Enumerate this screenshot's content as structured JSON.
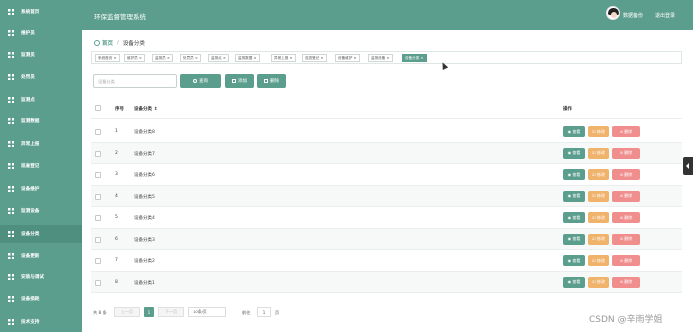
{
  "app_title": "环保监督管理系统",
  "header": {
    "user_name": "数据备份",
    "logout_label": "退出登录"
  },
  "sidebar": {
    "items": [
      {
        "label": "系统首页",
        "icon": "home-icon"
      },
      {
        "label": "维护员",
        "icon": "grid-icon"
      },
      {
        "label": "监测员",
        "icon": "grid-icon"
      },
      {
        "label": "处罚员",
        "icon": "grid-icon"
      },
      {
        "label": "监测点",
        "icon": "grid-icon"
      },
      {
        "label": "监测数据",
        "icon": "grid-icon"
      },
      {
        "label": "异常上报",
        "icon": "grid-icon"
      },
      {
        "label": "巡查登记",
        "icon": "grid-icon"
      },
      {
        "label": "设备维护",
        "icon": "grid-icon"
      },
      {
        "label": "监测设备",
        "icon": "briefcase-icon"
      },
      {
        "label": "设备分类",
        "icon": "grid-icon"
      },
      {
        "label": "设备更新",
        "icon": "grid-icon"
      },
      {
        "label": "安装与调试",
        "icon": "grid-icon"
      },
      {
        "label": "设备损耗",
        "icon": "pin-icon"
      },
      {
        "label": "技术支持",
        "icon": "grid-icon"
      }
    ],
    "active_index": 10
  },
  "breadcrumb": {
    "home": "首页",
    "separator": "/",
    "current": "设备分类"
  },
  "tabs": [
    "系统首页 ×",
    "维护员 ×",
    "监测员 ×",
    "处罚员 ×",
    "监测点 ×",
    "监测数据 ×",
    "异常上报 ×",
    "巡查登记 ×",
    "设备维护 ×",
    "监测设备 ×",
    "设备分类 ×"
  ],
  "search": {
    "placeholder": "设备分类",
    "value": "",
    "search_label": "查询",
    "add_label": "添加",
    "delete_label": "删除"
  },
  "table": {
    "columns": {
      "index": "序号",
      "name": "设备分类 ⇕",
      "actions": "操作"
    },
    "rows": [
      {
        "index": "1",
        "name": "设备分类8"
      },
      {
        "index": "2",
        "name": "设备分类7"
      },
      {
        "index": "3",
        "name": "设备分类6"
      },
      {
        "index": "4",
        "name": "设备分类5"
      },
      {
        "index": "5",
        "name": "设备分类4"
      },
      {
        "index": "6",
        "name": "设备分类3"
      },
      {
        "index": "7",
        "name": "设备分类2"
      },
      {
        "index": "8",
        "name": "设备分类1"
      }
    ],
    "actions": {
      "view": "◉ 查看",
      "edit": "☑ 修改",
      "delete": "⊘ 删除"
    }
  },
  "pagination": {
    "total": "共 8 条",
    "prev": "上一页",
    "current_page": "1",
    "next": "下一页",
    "page_size": "10条/页",
    "goto_label": "前往",
    "goto_value": "1",
    "page_suffix": "页"
  },
  "watermark": "CSDN @辛雨学姐",
  "colors": {
    "primary": "#5c9e8d",
    "edit": "#f0b36b",
    "delete": "#f08e8e"
  }
}
